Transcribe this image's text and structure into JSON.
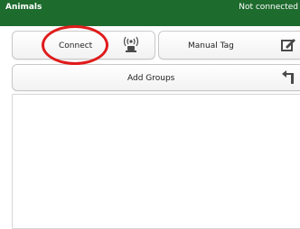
{
  "header": {
    "title": "Animals",
    "status": "Not connected"
  },
  "toolbar": {
    "connect_label": "Connect",
    "manual_tag_label": "Manual Tag",
    "add_groups_label": "Add Groups"
  },
  "icons": {
    "connect": "rfid-reader-icon",
    "manual_tag": "edit-tag-icon",
    "add_groups": "undo-arrow-icon"
  },
  "colors": {
    "header_bg": "#1e6b2e",
    "annotation": "#e01b1b"
  }
}
